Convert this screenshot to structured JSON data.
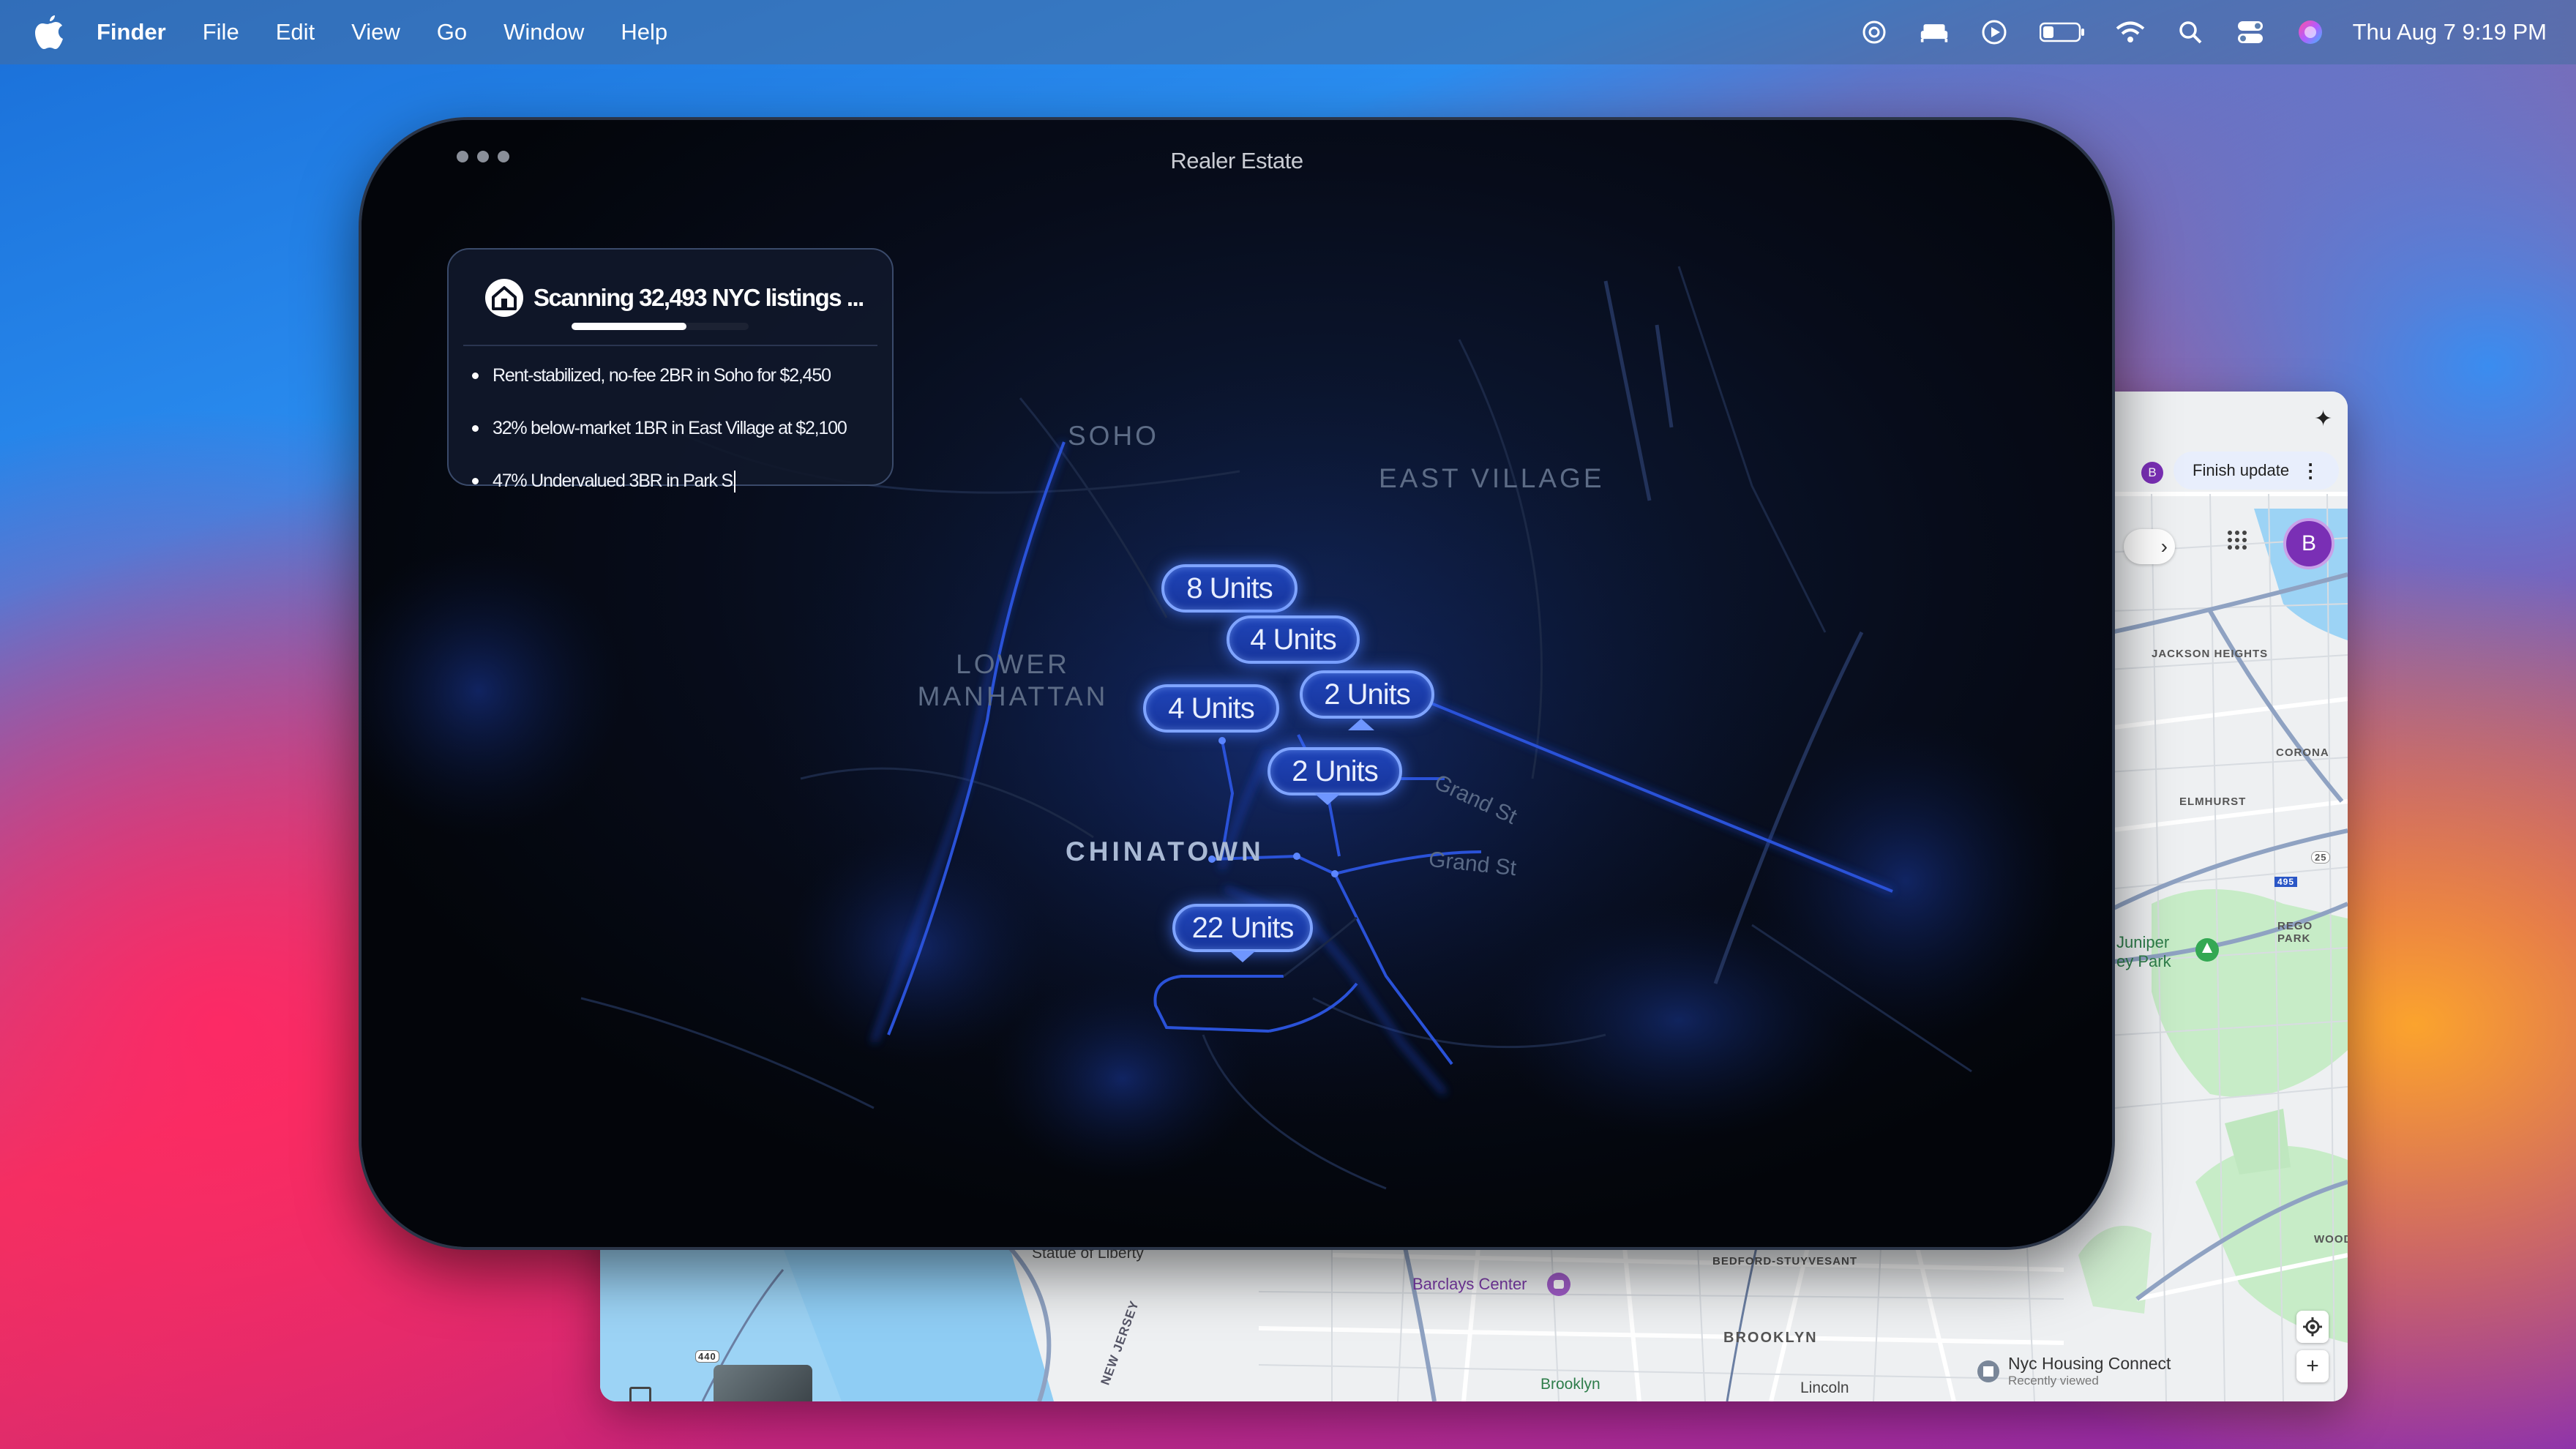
{
  "menubar": {
    "app_name": "Finder",
    "items": [
      "File",
      "Edit",
      "View",
      "Go",
      "Window",
      "Help"
    ],
    "clock": "Thu Aug 7  9:19 PM",
    "status_icons": [
      "chatgpt-icon",
      "bed-icon",
      "play-circle-icon",
      "battery-icon",
      "wifi-icon",
      "search-icon",
      "control-center-icon",
      "siri-icon"
    ]
  },
  "app_window": {
    "title": "Realer Estate",
    "scan": {
      "title": "Scanning 32,493 NYC listings ...",
      "progress": 0.65,
      "results": [
        "Rent-stabilized, no-fee 2BR in Soho for $2,450",
        "32% below-market 1BR in East Village at $2,100",
        "47% Undervalued 3BR in Park S"
      ]
    },
    "areas": {
      "soho": "SOHO",
      "east_village": "EAST VILLAGE",
      "lower_manhattan": "LOWER\nMANHATTAN",
      "chinatown": "CHINATOWN"
    },
    "streets": {
      "grand_1": "Grand St",
      "grand_2": "Grand St"
    },
    "pins": [
      {
        "label": "8 Units"
      },
      {
        "label": "4 Units"
      },
      {
        "label": "4 Units"
      },
      {
        "label": "2 Units"
      },
      {
        "label": "2 Units"
      },
      {
        "label": "22 Units"
      }
    ]
  },
  "maps_window": {
    "finish_update": "Finish update",
    "avatar_letter": "B",
    "labels": {
      "jackson_heights": "JACKSON\nHEIGHTS",
      "corona": "CORONA",
      "elmhurst": "ELMHURST",
      "rego_park": "REGO PARK",
      "juniper": "Juniper\ney Park",
      "bedford": "BEDFORD-STUYVESANT",
      "brooklyn": "BROOKLYN",
      "barclays": "Barclays Center",
      "statue": "Statue of Liberty",
      "new_jersey": "NEW JERSEY",
      "brooklyn_small": "Brooklyn",
      "lincoln": "Lincoln",
      "wood": "WOOD",
      "route_25": "25",
      "route_495": "495",
      "route_440": "440"
    },
    "nyc_housing": {
      "title": "Nyc Housing Connect",
      "subtitle": "Recently viewed"
    }
  }
}
